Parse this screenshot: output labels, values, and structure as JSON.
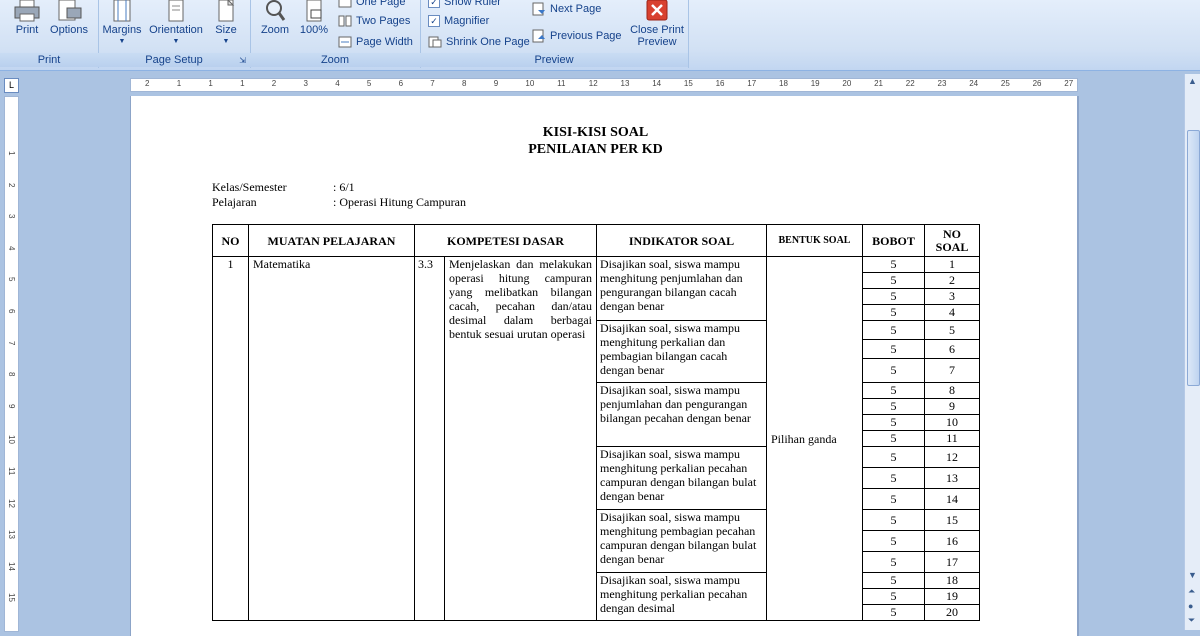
{
  "ribbon": {
    "print_group": {
      "label": "Print",
      "print": "Print",
      "options": "Options"
    },
    "page_setup_group": {
      "label": "Page Setup",
      "margins": "Margins",
      "orientation": "Orientation",
      "size": "Size"
    },
    "zoom_group": {
      "label": "Zoom",
      "zoom": "Zoom",
      "zoom100": "100%",
      "one_page": "One Page",
      "two_pages": "Two Pages",
      "page_width": "Page Width"
    },
    "preview_group": {
      "label": "Preview",
      "show_ruler": "Show Ruler",
      "magnifier": "Magnifier",
      "shrink": "Shrink One Page",
      "next_page": "Next Page",
      "previous_page": "Previous Page",
      "close_line1": "Close Print",
      "close_line2": "Preview"
    }
  },
  "ruler": {
    "h_ticks": [
      "2",
      "1",
      "1",
      "1",
      "2",
      "3",
      "4",
      "5",
      "6",
      "7",
      "8",
      "9",
      "10",
      "11",
      "12",
      "13",
      "14",
      "15",
      "16",
      "17",
      "18",
      "19",
      "20",
      "21",
      "22",
      "23",
      "24",
      "25",
      "26",
      "27"
    ],
    "v_ticks": [
      "1",
      "2",
      "3",
      "4",
      "5",
      "6",
      "7",
      "8",
      "9",
      "10",
      "11",
      "12",
      "13",
      "14",
      "15"
    ]
  },
  "document": {
    "title1": "KISI-KISI SOAL",
    "title2": "PENILAIAN PER KD",
    "kelas_label": "Kelas/Semester",
    "kelas_value": ": 6/1",
    "pelajaran_label": "Pelajaran",
    "pelajaran_value": ": Operasi  Hitung Campuran",
    "headers": {
      "no": "NO",
      "muatan": "MUATAN PELAJARAN",
      "kompetensi": "KOMPETESI DASAR",
      "indikator": "INDIKATOR  SOAL",
      "bentuk": "BENTUK SOAL",
      "bobot": "BOBOT",
      "no_soal": "NO SOAL"
    },
    "row": {
      "no": "1",
      "muatan": "Matematika",
      "kd_no": "3.3",
      "kd_text": "Menjelaskan dan melakukan operasi hitung campuran yang melibatkan bilangan cacah, pecahan dan/atau desimal dalam berbagai bentuk sesuai urutan operasi",
      "bentuk": "Pilihan ganda"
    },
    "indikator": [
      "Disajikan soal, siswa mampu menghitung penjumlahan dan pengurangan  bilangan cacah dengan benar",
      "Disajikan soal, siswa mampu menghitung perkalian dan pembagian bilangan cacah dengan benar",
      "Disajikan soal, siswa mampu penjumlahan dan pengurangan bilangan pecahan dengan benar",
      "Disajikan soal, siswa mampu menghitung perkalian pecahan campuran dengan bilangan bulat dengan benar",
      "Disajikan soal, siswa mampu menghitung pembagian pecahan campuran dengan bilangan bulat dengan benar",
      "Disajikan soal, siswa mampu menghitung perkalian pecahan dengan desimal"
    ],
    "soal": [
      {
        "bobot": "5",
        "no": "1"
      },
      {
        "bobot": "5",
        "no": "2"
      },
      {
        "bobot": "5",
        "no": "3"
      },
      {
        "bobot": "5",
        "no": "4"
      },
      {
        "bobot": "5",
        "no": "5"
      },
      {
        "bobot": "5",
        "no": "6"
      },
      {
        "bobot": "5",
        "no": "7"
      },
      {
        "bobot": "5",
        "no": "8"
      },
      {
        "bobot": "5",
        "no": "9"
      },
      {
        "bobot": "5",
        "no": "10"
      },
      {
        "bobot": "5",
        "no": "11"
      },
      {
        "bobot": "5",
        "no": "12"
      },
      {
        "bobot": "5",
        "no": "13"
      },
      {
        "bobot": "5",
        "no": "14"
      },
      {
        "bobot": "5",
        "no": "15"
      },
      {
        "bobot": "5",
        "no": "16"
      },
      {
        "bobot": "5",
        "no": "17"
      },
      {
        "bobot": "5",
        "no": "18"
      },
      {
        "bobot": "5",
        "no": "19"
      },
      {
        "bobot": "5",
        "no": "20"
      }
    ]
  }
}
